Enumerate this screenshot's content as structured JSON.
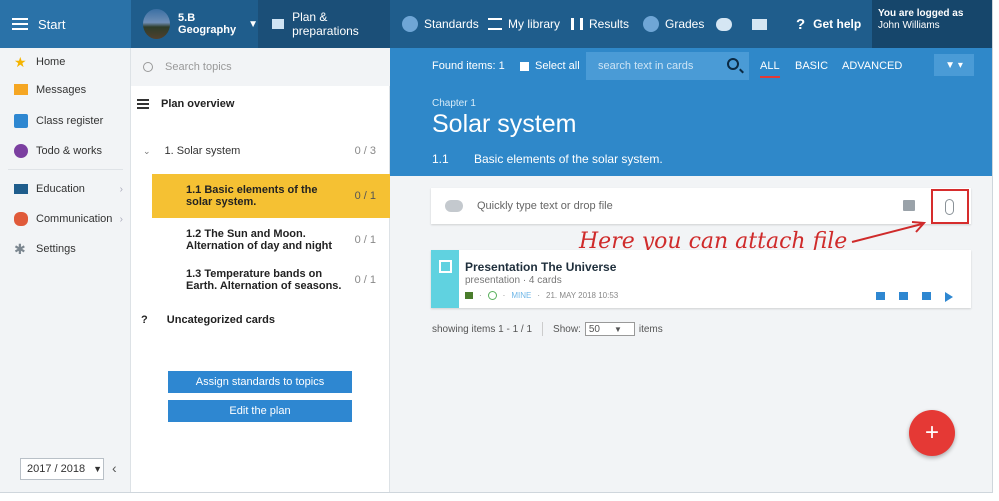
{
  "topbar": {
    "start_label": "Start",
    "class_line1": "5.B",
    "class_line2": "Geography",
    "plan_label": "Plan & preparations",
    "items": [
      {
        "label": "Standards",
        "icon": "shield-icon"
      },
      {
        "label": "My library",
        "icon": "library-icon"
      },
      {
        "label": "Results",
        "icon": "bar-chart-icon"
      },
      {
        "label": "Grades",
        "icon": "grades-icon"
      }
    ],
    "help_label": "Get help",
    "user_line1": "You are logged as",
    "user_line2": "John Williams"
  },
  "sidebar": {
    "items": [
      {
        "label": "Home",
        "icon": "star-icon",
        "color": "#f5b400"
      },
      {
        "label": "Messages",
        "icon": "envelope-icon",
        "color": "#f5a623"
      },
      {
        "label": "Class register",
        "icon": "register-icon",
        "color": "#2e87d1"
      },
      {
        "label": "Todo & works",
        "icon": "todo-icon",
        "color": "#7b3fa0"
      },
      {
        "label": "Education",
        "icon": "education-icon",
        "color": "#1f5d8c"
      },
      {
        "label": "Communication",
        "icon": "communication-icon",
        "color": "#e05a3a"
      },
      {
        "label": "Settings",
        "icon": "gear-icon",
        "color": "#7c8790"
      }
    ],
    "year": "2017 / 2018"
  },
  "topics": {
    "search_placeholder": "Search topics",
    "plan_overview": "Plan overview",
    "topic": {
      "label": "1. Solar system",
      "count": "0 / 3"
    },
    "subtopics": [
      {
        "line1": "1.1 Basic elements of the",
        "line2": "solar system.",
        "count": "0 / 1",
        "active": true
      },
      {
        "line1": "1.2 The Sun and Moon.",
        "line2": "Alternation of day and night",
        "count": "0 / 1",
        "active": false
      },
      {
        "line1": "1.3 Temperature bands on",
        "line2": "Earth. Alternation of seasons.",
        "count": "0 / 1",
        "active": false
      }
    ],
    "uncat_mark": "?",
    "uncat_label": "Uncategorized cards",
    "assign_button": "Assign standards to topics",
    "edit_button": "Edit the plan"
  },
  "main": {
    "found": "Found items: 1",
    "select_all": "Select all",
    "search_placeholder": "search text in cards",
    "filters": [
      "ALL",
      "BASIC",
      "ADVANCED"
    ],
    "chapter": "Chapter 1",
    "title": "Solar system",
    "sub_num": "1.1",
    "sub_title": "Basic elements of the solar system.",
    "quick_placeholder": "Quickly type text or drop file",
    "annotation": "Here you can attach file",
    "card": {
      "title": "Presentation The Universe",
      "meta": "presentation · 4 cards",
      "owner": "MINE",
      "date": "21. MAY 2018 10:53"
    },
    "paging": {
      "showing": "showing items 1 - 1 / 1",
      "show_label": "Show:",
      "show_value": "50",
      "items_label": "items"
    },
    "fab": "+"
  }
}
